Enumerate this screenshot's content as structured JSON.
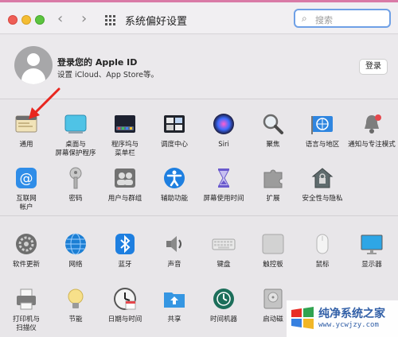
{
  "window": {
    "title": "系统偏好设置",
    "search_placeholder": "搜索"
  },
  "apple_id": {
    "title": "登录您的 Apple ID",
    "subtitle": "设置 iCloud、App Store等。",
    "login_label": "登录"
  },
  "row1": [
    {
      "label": "通用",
      "icon": "general-icon"
    },
    {
      "label": "桌面与\n屏幕保护程序",
      "icon": "desktop-icon"
    },
    {
      "label": "程序坞与\n菜单栏",
      "icon": "dock-icon"
    },
    {
      "label": "调度中心",
      "icon": "mission-control-icon"
    },
    {
      "label": "Siri",
      "icon": "siri-icon"
    },
    {
      "label": "聚焦",
      "icon": "spotlight-icon"
    },
    {
      "label": "语言与地区",
      "icon": "language-icon"
    },
    {
      "label": "通知与专注模式",
      "icon": "notification-icon"
    }
  ],
  "row2": [
    {
      "label": "互联网\n帐户",
      "icon": "internet-accounts-icon"
    },
    {
      "label": "密码",
      "icon": "passwords-icon"
    },
    {
      "label": "用户与群组",
      "icon": "users-icon"
    },
    {
      "label": "辅助功能",
      "icon": "accessibility-icon"
    },
    {
      "label": "屏幕使用时间",
      "icon": "screen-time-icon"
    },
    {
      "label": "扩展",
      "icon": "extensions-icon"
    },
    {
      "label": "安全性与隐私",
      "icon": "security-icon"
    }
  ],
  "row3": [
    {
      "label": "软件更新",
      "icon": "software-update-icon"
    },
    {
      "label": "网络",
      "icon": "network-icon"
    },
    {
      "label": "蓝牙",
      "icon": "bluetooth-icon"
    },
    {
      "label": "声音",
      "icon": "sound-icon"
    },
    {
      "label": "键盘",
      "icon": "keyboard-icon"
    },
    {
      "label": "触控板",
      "icon": "trackpad-icon"
    },
    {
      "label": "鼠标",
      "icon": "mouse-icon"
    },
    {
      "label": "显示器",
      "icon": "display-icon"
    }
  ],
  "row4": [
    {
      "label": "打印机与\n扫描仪",
      "icon": "printer-icon"
    },
    {
      "label": "节能",
      "icon": "energy-icon"
    },
    {
      "label": "日期与时间",
      "icon": "date-time-icon"
    },
    {
      "label": "共享",
      "icon": "sharing-icon"
    },
    {
      "label": "时间机器",
      "icon": "time-machine-icon"
    },
    {
      "label": "启动磁",
      "icon": "startup-disk-icon"
    }
  ],
  "watermark": {
    "title": "纯净系统之家",
    "url": "www.ycwjzy.com"
  },
  "colors": {
    "accent": "#3b82f6",
    "arrow": "#e8261f"
  }
}
